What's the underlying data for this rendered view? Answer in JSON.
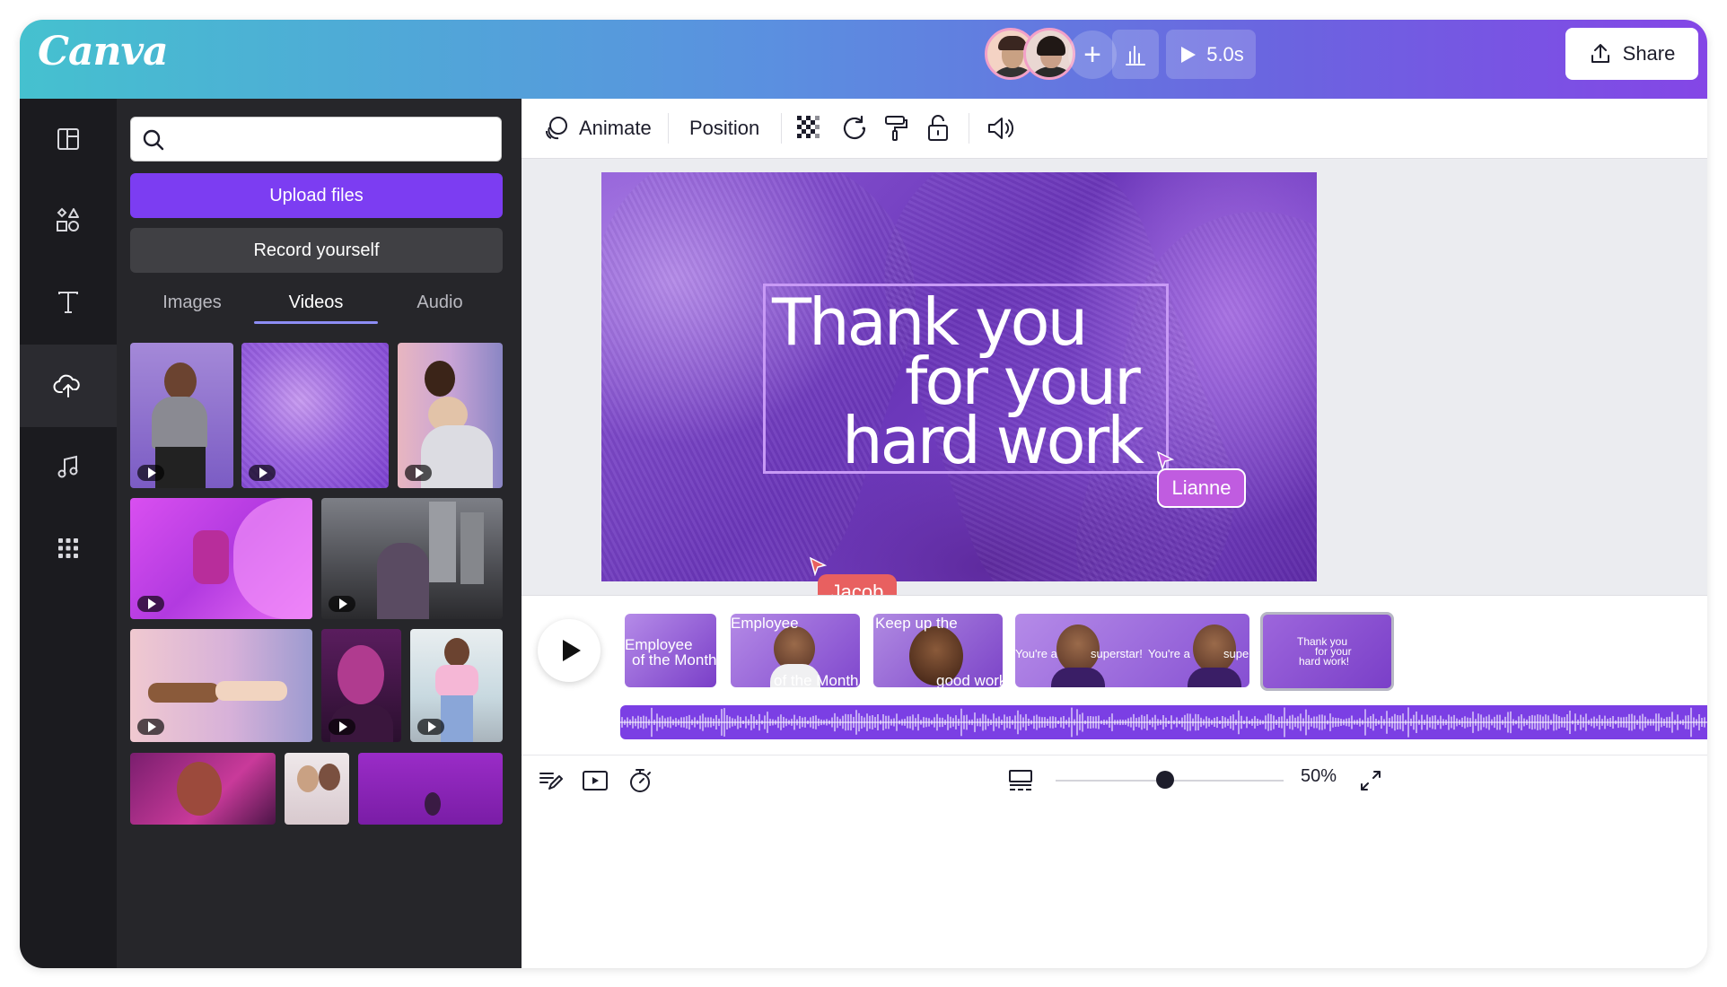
{
  "app": {
    "logo": "Canva"
  },
  "topbar": {
    "duration_label": "5.0s",
    "share_label": "Share",
    "add_label": "+"
  },
  "rail": {
    "items": [
      {
        "name": "design",
        "icon": "layout-icon"
      },
      {
        "name": "elements",
        "icon": "shapes-icon"
      },
      {
        "name": "text",
        "icon": "text-icon"
      },
      {
        "name": "uploads",
        "icon": "cloud-upload-icon",
        "active": true
      },
      {
        "name": "audio",
        "icon": "music-note-icon"
      },
      {
        "name": "apps",
        "icon": "grid-icon"
      }
    ]
  },
  "panel": {
    "search": {
      "value": "",
      "placeholder": ""
    },
    "upload_label": "Upload files",
    "record_label": "Record yourself",
    "tabs": [
      {
        "label": "Images",
        "active": false
      },
      {
        "label": "Videos",
        "active": true
      },
      {
        "label": "Audio",
        "active": false
      }
    ]
  },
  "toolbar": {
    "animate_label": "Animate",
    "position_label": "Position"
  },
  "slide": {
    "line1": "Thank you",
    "line2": "for your",
    "line3": "hard work"
  },
  "cursors": [
    {
      "name": "Lianne",
      "color": "#c05ce0"
    },
    {
      "name": "Jacob",
      "color": "#e86060"
    }
  ],
  "timeline": {
    "clips": [
      {
        "lines": [
          "Employee",
          "of the Month"
        ]
      },
      {
        "lines": [
          "Employee",
          "of the Month"
        ]
      },
      {
        "lines": [
          "Keep up the",
          "good work!"
        ]
      },
      {
        "lines": [
          "You're a",
          "superstar!",
          "You're a",
          "super"
        ]
      },
      {
        "lines": [
          "Thank you",
          "for your",
          "hard work!"
        ],
        "selected": true
      }
    ]
  },
  "bottombar": {
    "zoom": "50%",
    "zoom_fraction": 0.5
  },
  "colors": {
    "accent": "#7c3df2",
    "rail_bg": "#1b1b1f",
    "panel_bg": "#26262a"
  }
}
